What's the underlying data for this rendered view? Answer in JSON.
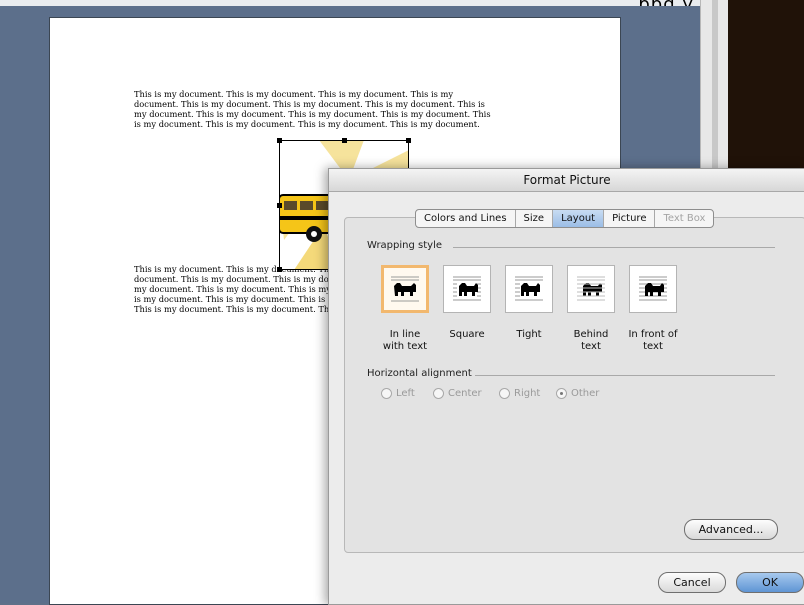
{
  "ruler": {
    "top_text": "ppg y"
  },
  "document": {
    "paragraph_1": "This is my document.  This is my document.  This is my document.  This is my\ndocument. This is my document.  This is my document.  This is my document.  This is\nmy document.  This is my document.  This is my document.  This is my document.  This\nis my document.  This is my document.  This is my document.  This is my document.",
    "paragraph_2": "This is my document.  This is my document.  This is my document.  This is my\ndocument.  This is my document.  This is my document.  This is my document.  This is\nmy document.  This is my document.  This is my document.  This is my document.  This\nis my document.  This is my document.  This is my document.  This is my document.\nThis is my document.  This is my document.  This is my document.  This is my document."
  },
  "dialog": {
    "title": "Format Picture",
    "tabs": [
      {
        "label": "Colors and Lines",
        "state": "normal"
      },
      {
        "label": "Size",
        "state": "normal"
      },
      {
        "label": "Layout",
        "state": "active"
      },
      {
        "label": "Picture",
        "state": "normal"
      },
      {
        "label": "Text Box",
        "state": "disabled"
      }
    ],
    "wrapping_style_label": "Wrapping style",
    "wrapping_options": [
      {
        "label": "In line\nwith text",
        "icon": "wrap-inline-icon",
        "selected": true
      },
      {
        "label": "Square",
        "icon": "wrap-square-icon",
        "selected": false
      },
      {
        "label": "Tight",
        "icon": "wrap-tight-icon",
        "selected": false
      },
      {
        "label": "Behind\ntext",
        "icon": "wrap-behind-icon",
        "selected": false
      },
      {
        "label": "In front of\ntext",
        "icon": "wrap-front-icon",
        "selected": false
      }
    ],
    "horizontal_alignment_label": "Horizontal alignment",
    "alignment_options": [
      {
        "label": "Left",
        "checked": false
      },
      {
        "label": "Center",
        "checked": false
      },
      {
        "label": "Right",
        "checked": false
      },
      {
        "label": "Other",
        "checked": true
      }
    ],
    "advanced_button": "Advanced...",
    "cancel_button": "Cancel",
    "ok_button": "OK"
  },
  "colors": {
    "workspace": "#5c6f8b",
    "selected_wrap_border": "#f2b86e",
    "default_button": "#5f95d4"
  }
}
